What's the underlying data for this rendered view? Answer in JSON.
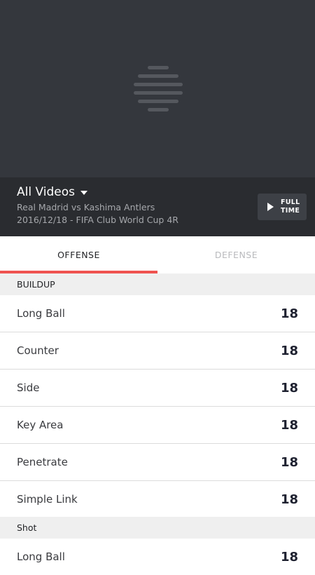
{
  "video": {
    "title": "All Videos",
    "match": "Real Madrid vs Kashima Antlers",
    "details": "2016/12/18 - FIFA Club World Cup 4R",
    "fulltime_label": "FULL TIME"
  },
  "tabs": [
    {
      "label": "OFFENSE",
      "active": true
    },
    {
      "label": "DEFENSE",
      "active": false
    }
  ],
  "sections": [
    {
      "title": "BUILDUP",
      "rows": [
        {
          "label": "Long Ball",
          "value": "18"
        },
        {
          "label": "Counter",
          "value": "18"
        },
        {
          "label": "Side",
          "value": "18"
        },
        {
          "label": "Key Area",
          "value": "18"
        },
        {
          "label": "Penetrate",
          "value": "18"
        },
        {
          "label": "Simple Link",
          "value": "18"
        }
      ]
    },
    {
      "title": "Shot",
      "rows": [
        {
          "label": "Long Ball",
          "value": "18"
        }
      ]
    }
  ],
  "colors": {
    "accent": "#ef5350",
    "video_bg": "#34373d",
    "info_bg": "#2a2c30"
  }
}
